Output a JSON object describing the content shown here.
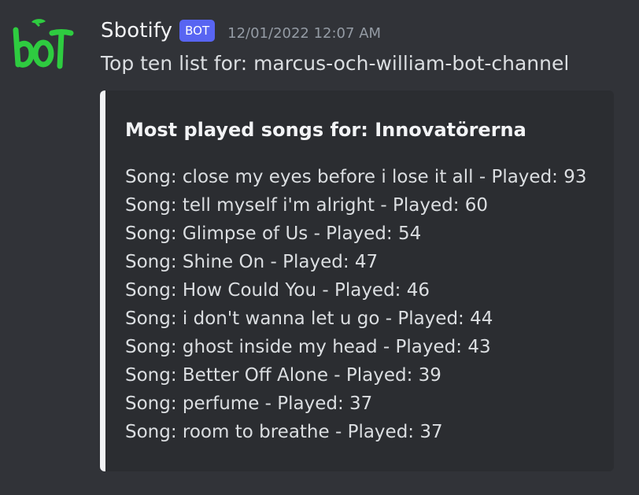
{
  "message": {
    "avatar_icon": "bot-logo-icon",
    "avatar_text": "bOT",
    "username": "Sbotify",
    "bot_tag": "BOT",
    "timestamp": "12/01/2022 12:07 AM",
    "content": "Top ten list for: marcus-och-william-bot-channel",
    "colors": {
      "accent_bot_tag": "#5865f2",
      "avatar_green": "#2ecc40",
      "embed_bar": "#f2f3f5"
    }
  },
  "embed": {
    "title": "Most played songs for: Innovatörerna",
    "items": [
      "Song: close my eyes before i lose it all - Played: 93",
      "Song: tell myself i'm alright - Played: 60",
      "Song: Glimpse of Us - Played: 54",
      "Song: Shine On - Played: 47",
      "Song: How Could You - Played: 46",
      "Song: i don't wanna let u go - Played: 44",
      "Song: ghost inside my head - Played: 43",
      "Song: Better Off Alone - Played: 39",
      "Song: perfume - Played: 37",
      "Song: room to breathe - Played: 37"
    ]
  }
}
